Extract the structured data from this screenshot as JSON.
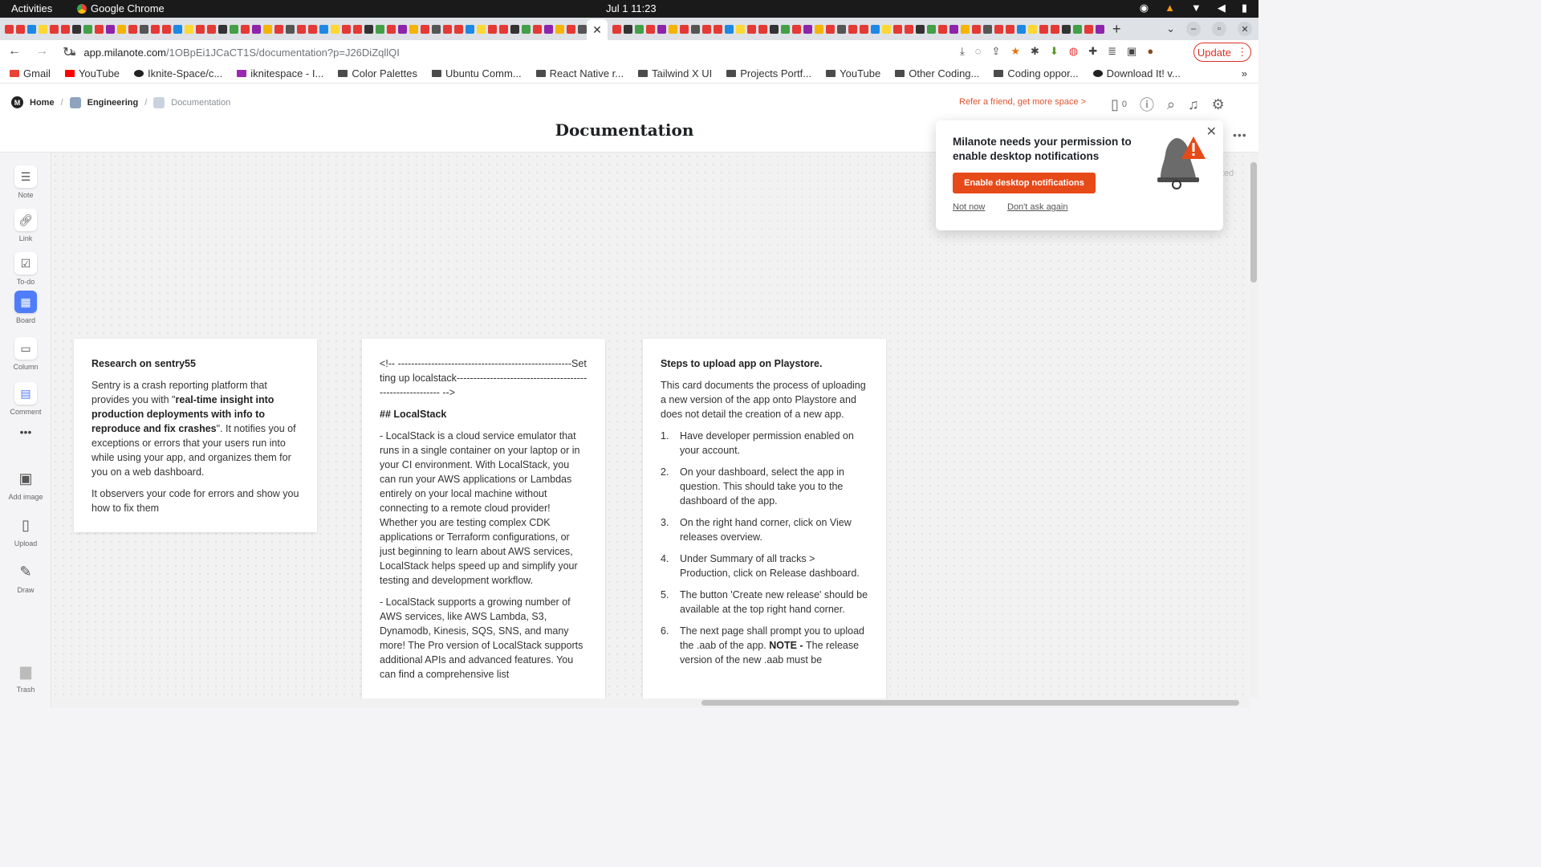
{
  "os": {
    "activities": "Activities",
    "app_name": "Google Chrome",
    "clock": "Jul 1  11:23"
  },
  "browser": {
    "url_host": "app.milanote.com",
    "url_path": "/1OBpEi1JCaCT1S/documentation?p=J26DiZqllQI",
    "update_label": "Update",
    "bookmarks": [
      "Gmail",
      "YouTube",
      "Iknite-Space/c...",
      "iknitespace - I...",
      "Color Palettes",
      "Ubuntu Comm...",
      "React Native r...",
      "Tailwind X UI",
      "Projects Portf...",
      "YouTube",
      "Other Coding...",
      "Coding oppor...",
      "Download It! v..."
    ]
  },
  "header": {
    "crumbs": {
      "home": "Home",
      "engineering": "Engineering",
      "documentation": "Documentation"
    },
    "title": "Documentation",
    "refer": "Refer a friend, get more space >",
    "device_count": "0"
  },
  "sidebar": {
    "tools": [
      {
        "label": "Note"
      },
      {
        "label": "Link"
      },
      {
        "label": "To-do"
      },
      {
        "label": "Board"
      },
      {
        "label": "Column"
      },
      {
        "label": "Comment"
      },
      {
        "label": "Add image"
      },
      {
        "label": "Upload"
      },
      {
        "label": "Draw"
      },
      {
        "label": "Trash"
      }
    ]
  },
  "cards": {
    "sentry": {
      "title": "Research on sentry55",
      "p1a": "Sentry is a crash reporting platform that provides you with \"",
      "p1b": "real-time insight into production deployments with info to reproduce and fix crashes",
      "p1c": "\". It notifies you of exceptions or errors that your users run into while using your app, and organizes them for you on a web dashboard.",
      "p2": "It observers your code for errors and show you how to fix them"
    },
    "localstack": {
      "comment": "<!--  ----------------------------------------------------Setting up localstack--------------------------------------------------------- -->",
      "heading": "## LocalStack",
      "p1": "- LocalStack is a cloud service emulator that runs in a single container on your laptop or in your CI environment. With LocalStack, you can run your AWS applications or Lambdas entirely on your local machine without connecting to a remote cloud provider! Whether you are testing complex CDK applications or Terraform configurations, or just beginning to learn about AWS services, LocalStack helps speed up and simplify your testing and development workflow.",
      "p2": "- LocalStack supports a growing number of AWS services, like AWS Lambda, S3, Dynamodb, Kinesis, SQS, SNS, and many more! The Pro version of LocalStack supports additional APIs and advanced features. You can find a comprehensive list"
    },
    "playstore": {
      "title": "Steps to upload app on Playstore.",
      "intro": "This card documents the process of uploading a new version of the app onto Playstore and does not detail the creation of a new app.",
      "steps": [
        {
          "n": "1.",
          "text": "Have developer permission enabled on your account."
        },
        {
          "n": "2.",
          "text": "On your dashboard, select the app in question. This should take you to the dashboard of the app."
        },
        {
          "n": "3.",
          "text": "On the right hand corner, click on View releases overview."
        },
        {
          "n": "4.",
          "text": "Under Summary of all tracks > Production, click on Release dashboard."
        },
        {
          "n": "5.",
          "text": "The button 'Create new release' should be available at the top right hand corner."
        }
      ],
      "step6_n": "6.",
      "step6a": "The next page shall prompt you to upload the .aab of the app. ",
      "step6b": "NOTE - ",
      "step6c": "The release version of the new .aab must be"
    }
  },
  "notification": {
    "message": "Milanote needs your permission to enable desktop notifications",
    "enable": "Enable desktop notifications",
    "not_now": "Not now",
    "dont_ask": "Don't ask again",
    "accent": "#e64a19"
  },
  "background_hint": "ted"
}
